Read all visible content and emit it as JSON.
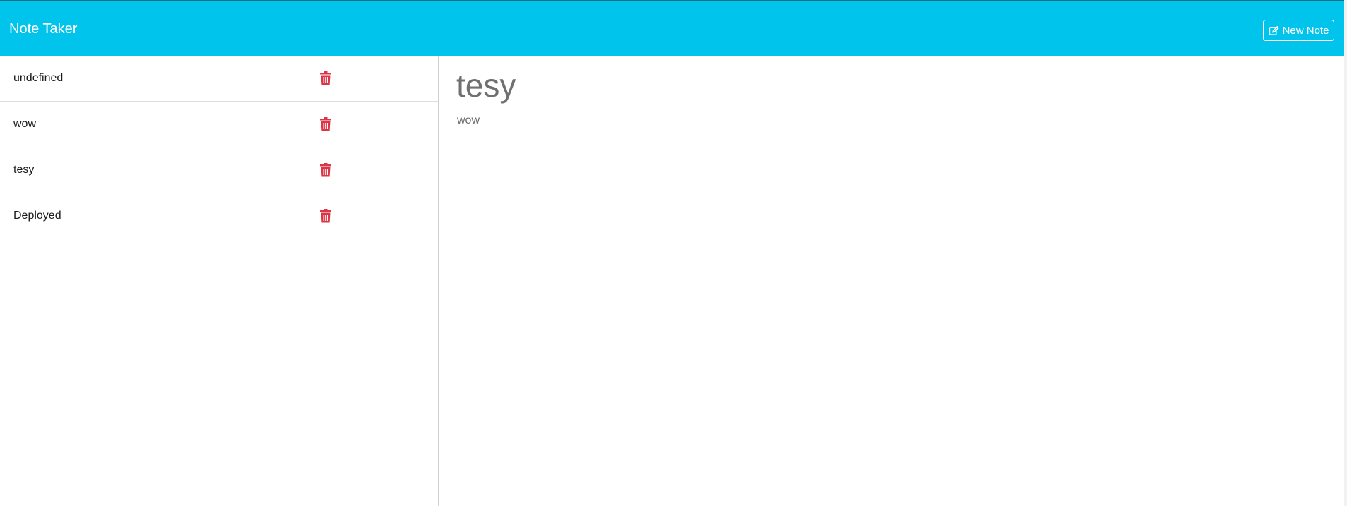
{
  "navbar": {
    "brand": "Note Taker",
    "new_note_label": "New Note",
    "background_color": "#00c4ec"
  },
  "sidebar": {
    "notes": [
      {
        "title": "undefined",
        "delete_icon": "trash-icon"
      },
      {
        "title": "wow",
        "delete_icon": "trash-icon"
      },
      {
        "title": "tesy",
        "delete_icon": "trash-icon"
      },
      {
        "title": "Deployed",
        "delete_icon": "trash-icon"
      }
    ],
    "delete_icon_color": "#dc3545"
  },
  "main": {
    "active_note_title": "tesy",
    "active_note_text": "wow"
  }
}
